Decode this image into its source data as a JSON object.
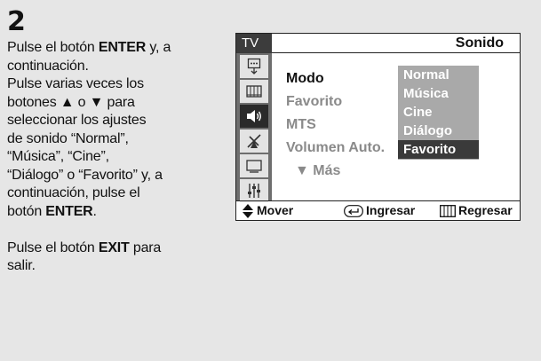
{
  "step": {
    "number": "2"
  },
  "instructions": {
    "p1": [
      {
        "pre": "Pulse el botón ",
        "bold": "ENTER",
        "post": " y, a"
      },
      {
        "pre": "continuación.",
        "bold": "",
        "post": ""
      },
      {
        "pre": "Pulse varias veces los",
        "bold": "",
        "post": ""
      },
      {
        "pre": "botones ▲ o ▼ para",
        "bold": "",
        "post": ""
      },
      {
        "pre": "seleccionar los ajustes",
        "bold": "",
        "post": ""
      },
      {
        "pre": "de sonido “Normal”,",
        "bold": "",
        "post": ""
      },
      {
        "pre": "“Música”, “Cine”,",
        "bold": "",
        "post": ""
      },
      {
        "pre": "“Diálogo” o “Favorito” y, a",
        "bold": "",
        "post": ""
      },
      {
        "pre": "continuación, pulse el",
        "bold": "",
        "post": ""
      },
      {
        "pre": "botón ",
        "bold": "ENTER",
        "post": "."
      }
    ],
    "p2": [
      {
        "pre": "Pulse el botón ",
        "bold": "EXIT",
        "post": " para"
      },
      {
        "pre": "salir.",
        "bold": "",
        "post": ""
      }
    ]
  },
  "osd": {
    "tab_label": "TV",
    "title": "Sonido",
    "icons": [
      "picture-icon",
      "channel-icon",
      "sound-icon",
      "setup-icon",
      "input-icon",
      "equalizer-icon"
    ],
    "menu": {
      "items": [
        "Modo",
        "Favorito",
        "MTS",
        "Volumen Auto."
      ],
      "more": "▼ Más"
    },
    "options": [
      "Normal",
      "Música",
      "Cine",
      "Diálogo",
      "Favorito"
    ],
    "selected_option": "Favorito",
    "footer": {
      "move": "Mover",
      "enter": "Ingresar",
      "return": "Regresar"
    }
  }
}
